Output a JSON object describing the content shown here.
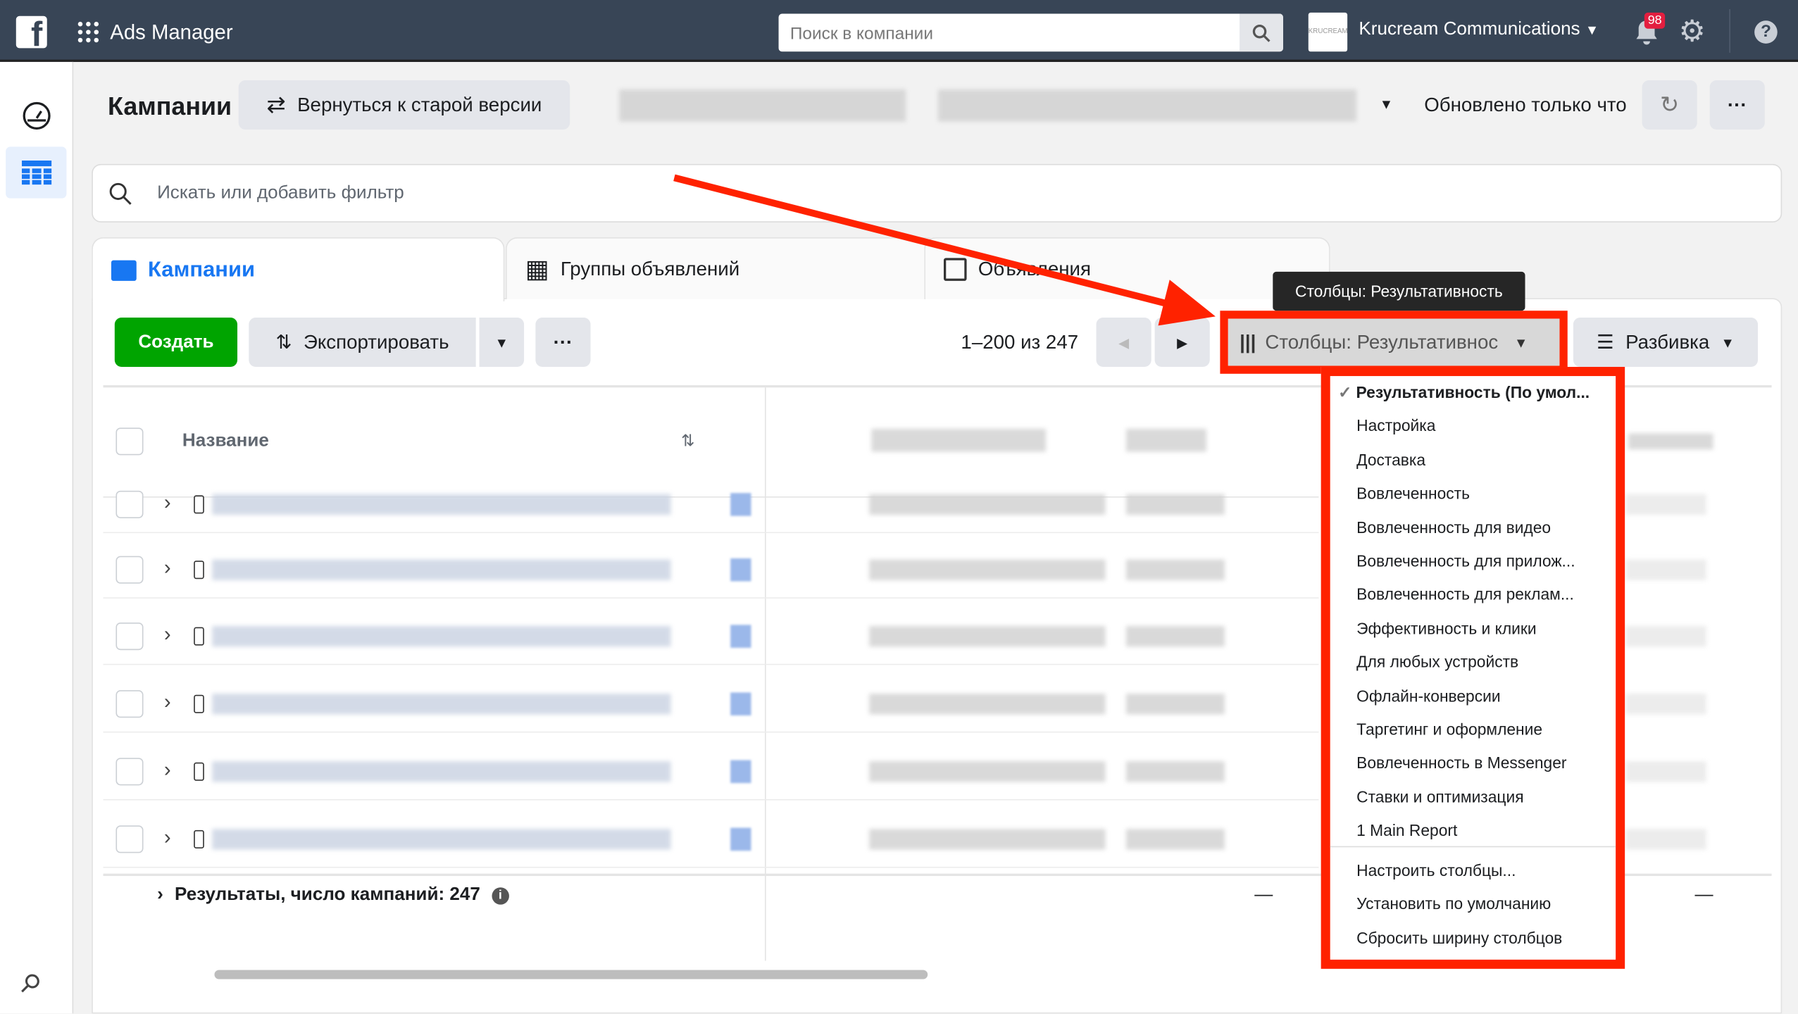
{
  "topbar": {
    "app_title": "Ads Manager",
    "search_placeholder": "Поиск в компании",
    "account_name": "Krucream Communications",
    "account_logo_text": "KRUCREAM",
    "notifications_count": "98"
  },
  "header": {
    "title": "Кампании",
    "back_button": "Вернуться к старой версии",
    "updated": "Обновлено только что"
  },
  "filter": {
    "placeholder": "Искать или добавить фильтр"
  },
  "tabs": [
    {
      "label": "Кампании",
      "active": true
    },
    {
      "label": "Группы объявлений"
    },
    {
      "label": "Объявления"
    }
  ],
  "toolbar": {
    "create": "Создать",
    "export": "Экспортировать",
    "pagination": "1–200 из 247",
    "columns": "Столбцы: Результативнос",
    "breakdown": "Разбивка"
  },
  "tooltip": "Столбцы: Результативность",
  "columns_menu": {
    "presets": [
      "Результативность (По умол...",
      "Настройка",
      "Доставка",
      "Вовлеченность",
      "Вовлеченность для видео",
      "Вовлеченность для прилож...",
      "Вовлеченность для реклам...",
      "Эффективность и клики",
      "Для любых устройств",
      "Офлайн-конверсии",
      "Таргетинг и оформление",
      "Вовлеченность в Messenger",
      "Ставки и оптимизация",
      "1 Main Report"
    ],
    "selected_index": 0,
    "actions": [
      "Настроить столбцы...",
      "Установить по умолчанию",
      "Сбросить ширину столбцов"
    ]
  },
  "table": {
    "name_header": "Название",
    "summary": "Результаты, число кампаний: 247",
    "summary_dash": "—"
  },
  "colors": {
    "topbar": "#384556",
    "accent": "#1877f2",
    "create": "#00a400",
    "highlight": "#ff2200"
  }
}
